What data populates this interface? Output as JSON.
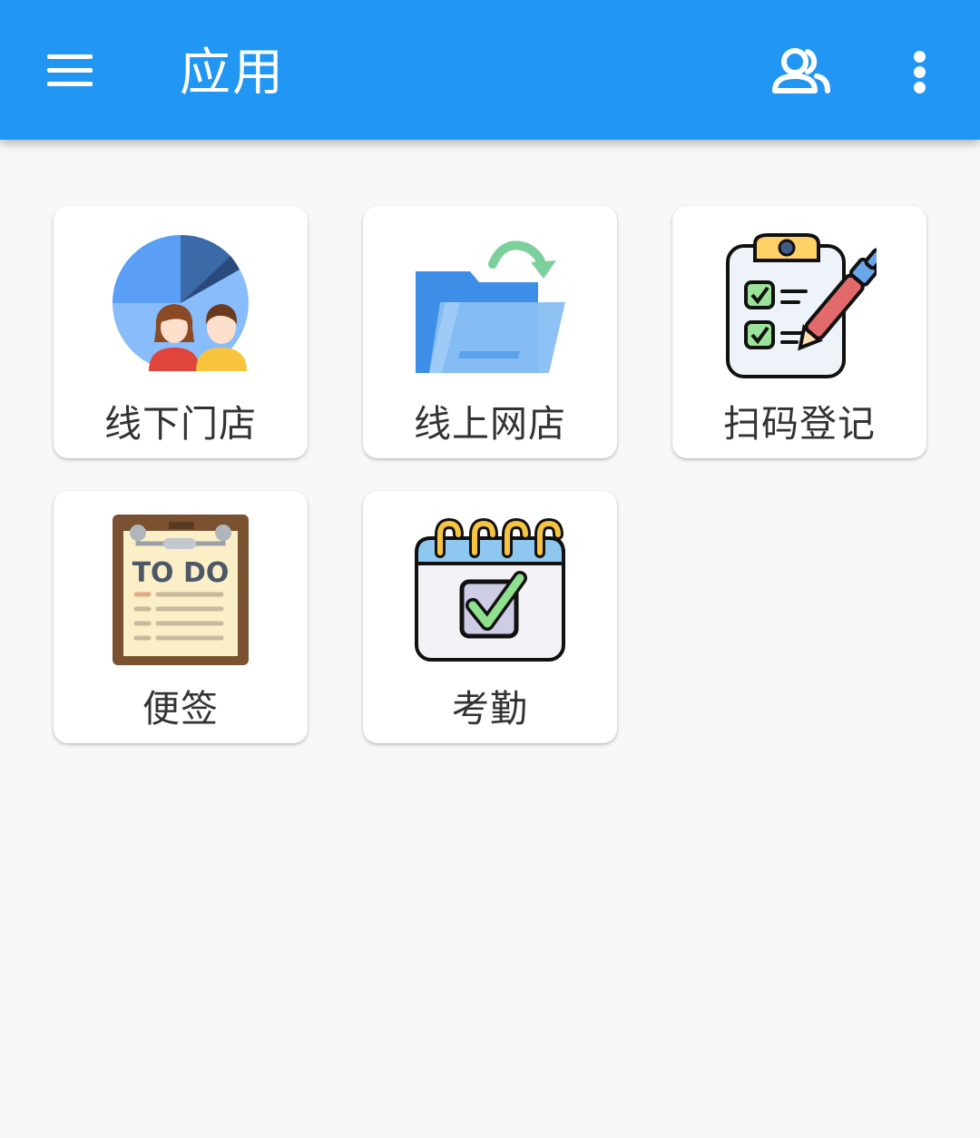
{
  "appbar": {
    "title": "应用",
    "menu_icon": "hamburger-menu-icon",
    "contacts_icon": "people-icon",
    "more_icon": "more-vert-icon",
    "color": "#2196f3"
  },
  "apps": [
    {
      "label": "线下门店",
      "icon": "store-people-pie-chart-icon"
    },
    {
      "label": "线上网店",
      "icon": "online-folder-sync-icon"
    },
    {
      "label": "扫码登记",
      "icon": "clipboard-checklist-icon"
    },
    {
      "label": "便签",
      "icon": "todo-notepad-icon",
      "icon_text": "TO DO"
    },
    {
      "label": "考勤",
      "icon": "calendar-check-icon"
    }
  ]
}
